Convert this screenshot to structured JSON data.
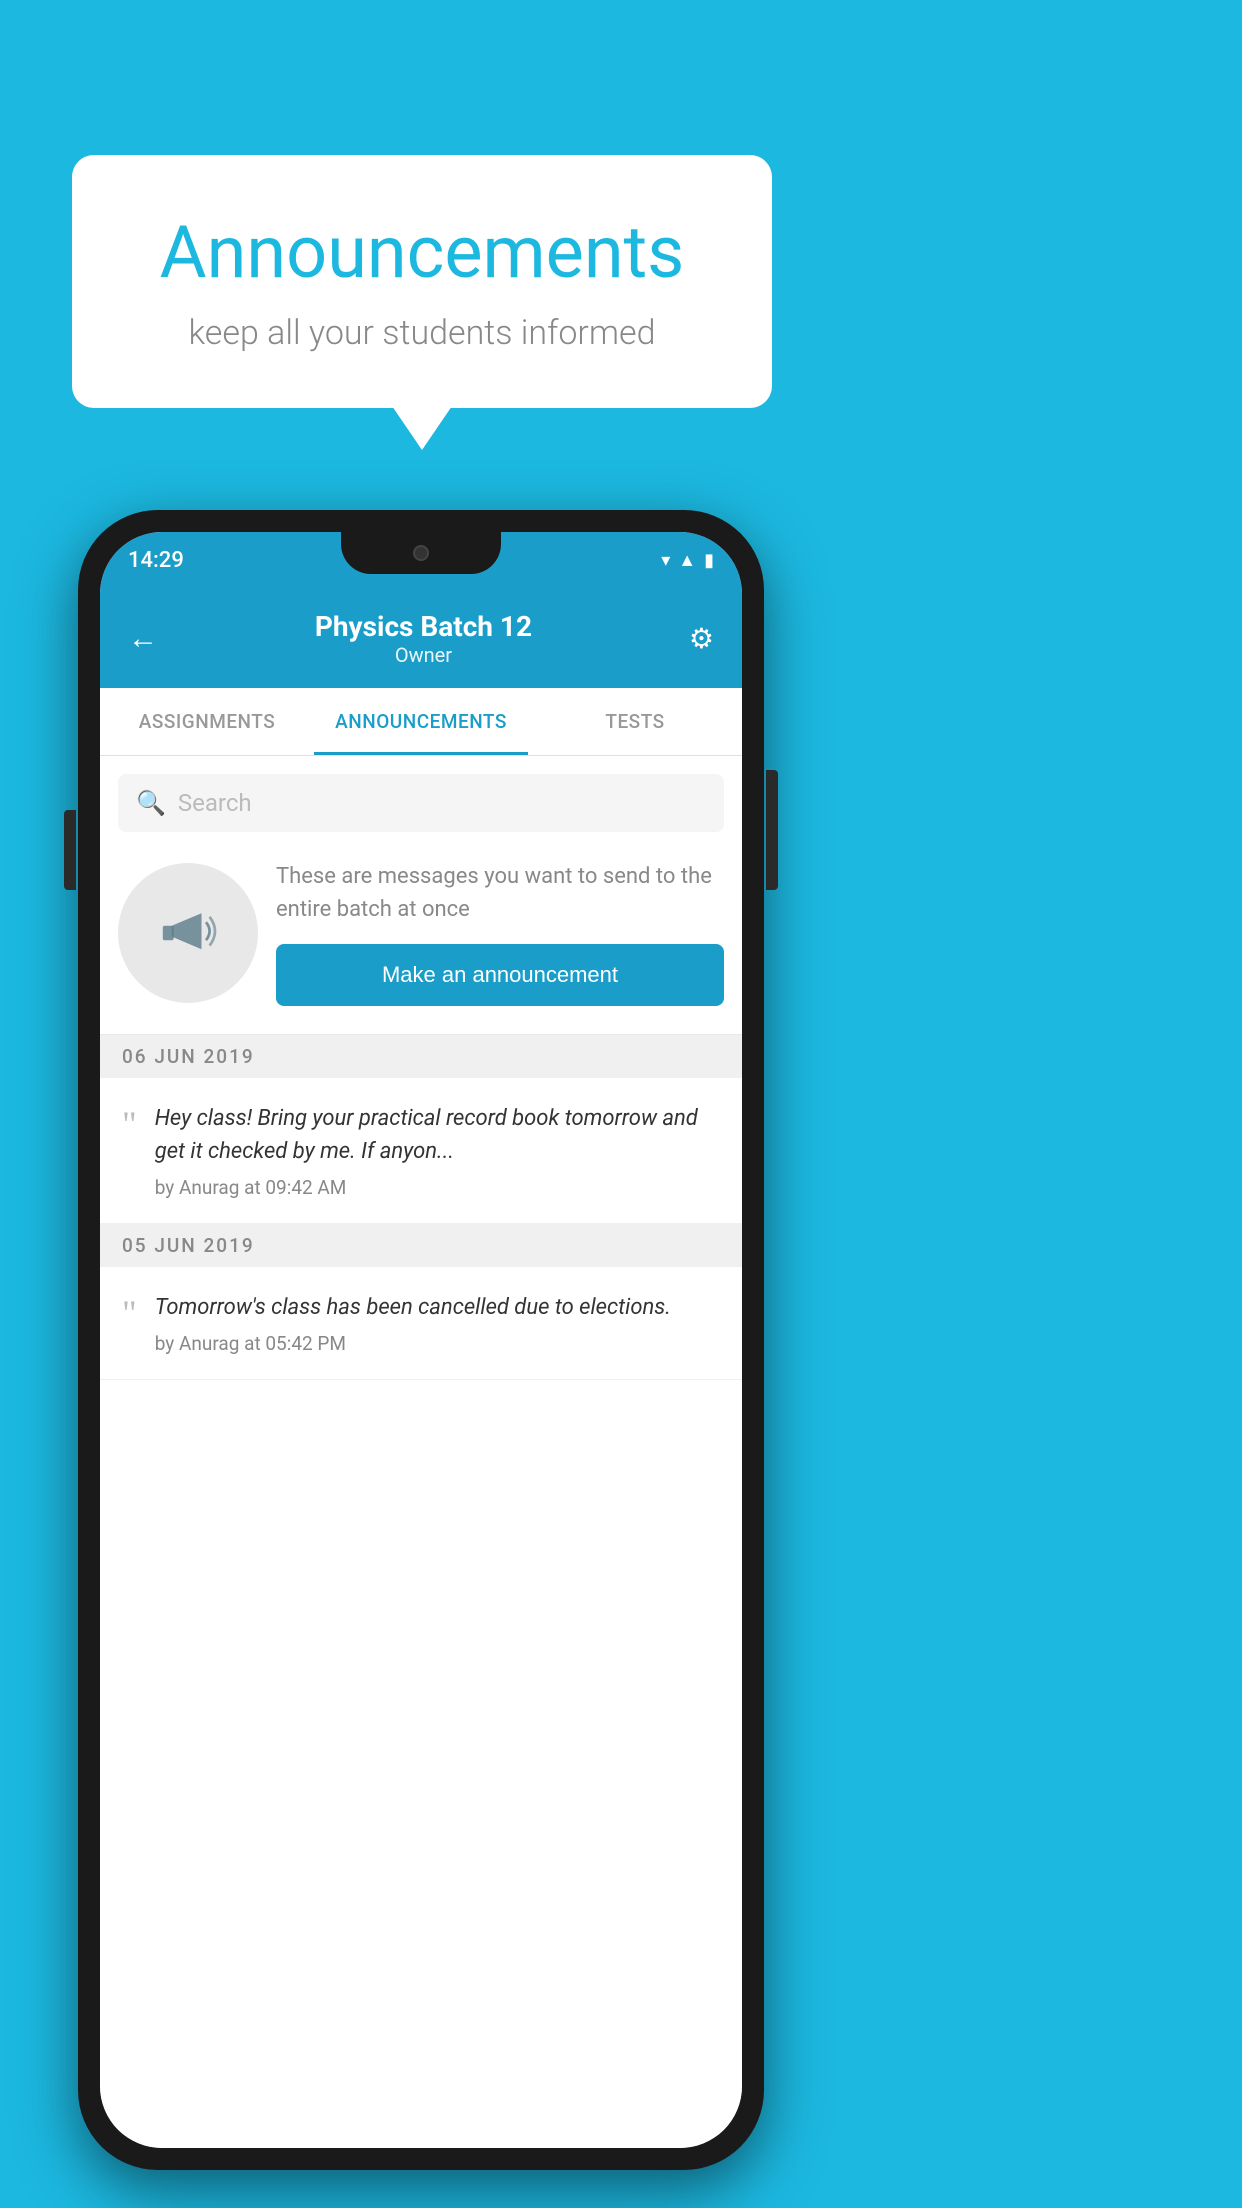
{
  "background_color": "#1cb8e0",
  "speech_bubble": {
    "title": "Announcements",
    "subtitle": "keep all your students informed"
  },
  "phone": {
    "status_bar": {
      "time": "14:29",
      "icons": [
        "wifi",
        "signal",
        "battery"
      ]
    },
    "header": {
      "title": "Physics Batch 12",
      "subtitle": "Owner",
      "back_label": "←",
      "settings_label": "⚙"
    },
    "tabs": [
      {
        "label": "ASSIGNMENTS",
        "active": false
      },
      {
        "label": "ANNOUNCEMENTS",
        "active": true
      },
      {
        "label": "TESTS",
        "active": false
      }
    ],
    "search": {
      "placeholder": "Search"
    },
    "promo": {
      "description": "These are messages you want to send to the entire batch at once",
      "button_label": "Make an announcement"
    },
    "announcements": [
      {
        "date": "06  JUN  2019",
        "text": "Hey class! Bring your practical record book tomorrow and get it checked by me. If anyon...",
        "meta": "by Anurag at 09:42 AM"
      },
      {
        "date": "05  JUN  2019",
        "text": "Tomorrow's class has been cancelled due to elections.",
        "meta": "by Anurag at 05:42 PM"
      }
    ]
  }
}
